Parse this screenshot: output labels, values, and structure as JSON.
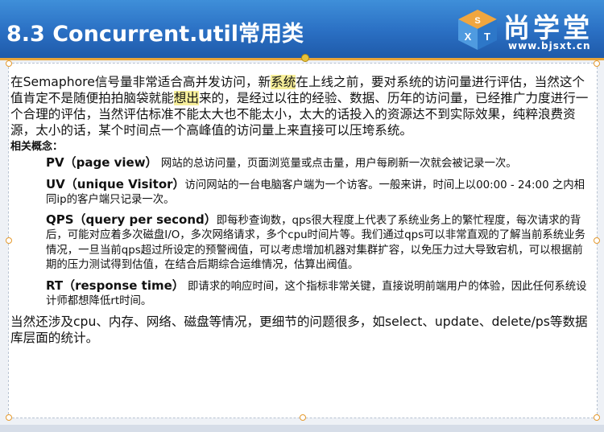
{
  "header": {
    "title": "8.3 Concurrent.util常用类",
    "logo_brand": "尚学堂",
    "logo_url": "www.bjsxt.cn",
    "logo_letters": [
      "S",
      "X",
      "T"
    ]
  },
  "colors": {
    "header_blue": "#2a6fc3",
    "accent_orange": "#e8a53a",
    "highlight_yellow": "#f7ef9a"
  },
  "content": {
    "intro_part1": "在Semaphore信号量非常适合高并发访问，新",
    "intro_highlight1": "系统",
    "intro_part2": "在上线之前，要对系统的访问量进行评估，当然这个值肯定不是随便拍拍脑袋就能",
    "intro_highlight2": "想出",
    "intro_part3": "来的，是经过以往的经验、数据、历年的访问量，已经推广力度进行一个合理的评估，当然评估标准不能太大也不能太小，太大的话投入的资源达不到实际效果，纯粹浪费资源，太小的话，某个时间点一个高峰值的访问量上来直接可以压垮系统。",
    "concepts_label": "相关概念：",
    "pv_term": "PV（page view）",
    "pv_text": "网站的总访问量，页面浏览量或点击量，用户每刷新一次就会被记录一次。",
    "uv_term": "UV（unique Visitor）",
    "uv_text": "访问网站的一台电脑客户端为一个访客。一般来讲，时间上以00:00 - 24:00 之内相同ip的客户端只记录一次。",
    "qps_term": "QPS（query per second）",
    "qps_text": "即每秒查询数，qps很大程度上代表了系统业务上的繁忙程度，每次请求的背后，可能对应着多次磁盘I/O，多次网络请求，多个cpu时间片等。我们通过qps可以非常直观的了解当前系统业务情况，一旦当前qps超过所设定的预警阀值，可以考虑增加机器对集群扩容，以免压力过大导致宕机，可以根据前期的压力测试得到估值，在结合后期综合运维情况，估算出阀值。",
    "rt_term": "RT（response time）",
    "rt_text": "即请求的响应时间，这个指标非常关键，直接说明前端用户的体验，因此任何系统设计师都想降低rt时间。",
    "closing": "当然还涉及cpu、内存、网络、磁盘等情况，更细节的问题很多，如select、update、delete/ps等数据库层面的统计。"
  }
}
